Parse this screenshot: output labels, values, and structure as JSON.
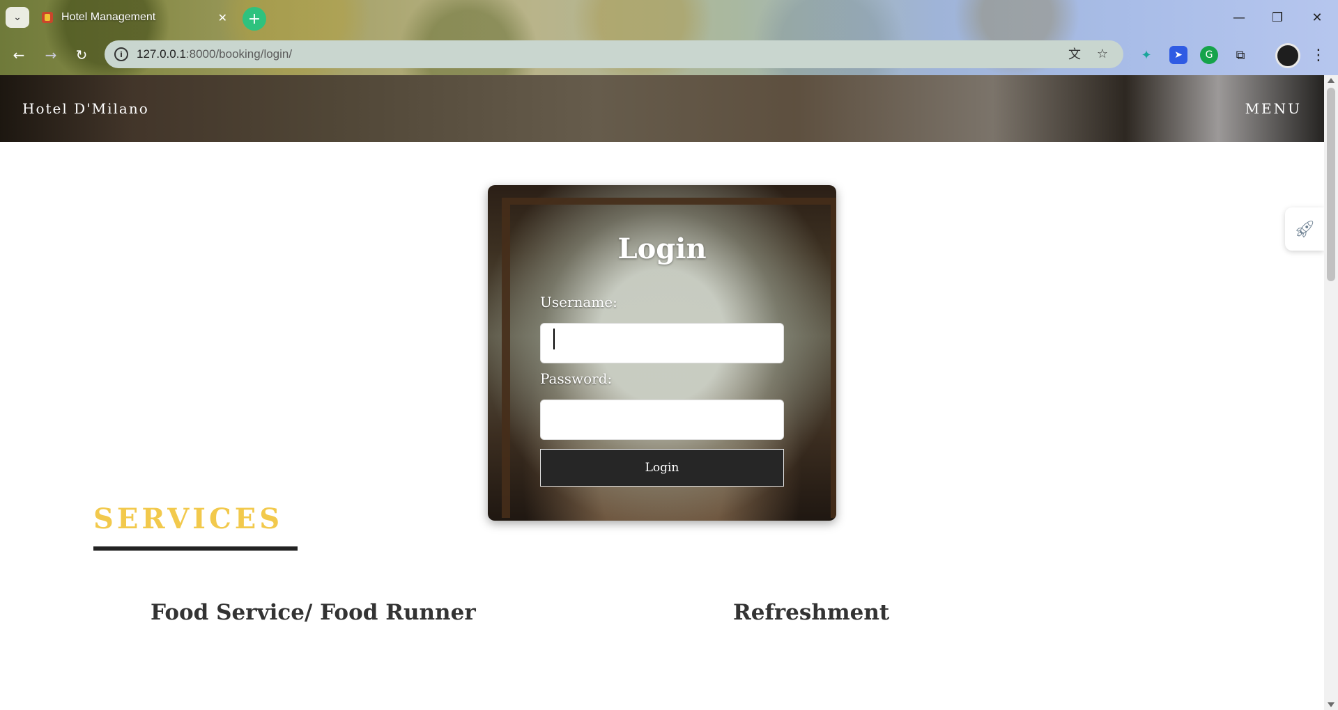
{
  "browser": {
    "tab_title": "Hotel Management",
    "tab_close": "✕",
    "new_tab": "+",
    "url_host": "127.0.0.1",
    "url_path": ":8000/booking/login/",
    "icons": {
      "back": "←",
      "forward": "→",
      "reload": "↻",
      "info": "i",
      "translate": "文",
      "star": "☆",
      "minimize": "—",
      "restore": "❐",
      "close": "✕",
      "kebab": "⋮"
    }
  },
  "site": {
    "brand": "Hotel D'Milano",
    "menu": "MENU"
  },
  "login": {
    "title": "Login",
    "username_label": "Username:",
    "username_value": "",
    "password_label": "Password:",
    "password_value": "",
    "submit_label": "Login"
  },
  "services": {
    "title": "SERVICES",
    "items": [
      {
        "name": "Food Service/ Food Runner"
      },
      {
        "name": "Refreshment"
      }
    ]
  },
  "colors": {
    "services_accent": "#f2c94c",
    "button_bg": "#262626",
    "new_tab_green": "#2ec27e"
  }
}
